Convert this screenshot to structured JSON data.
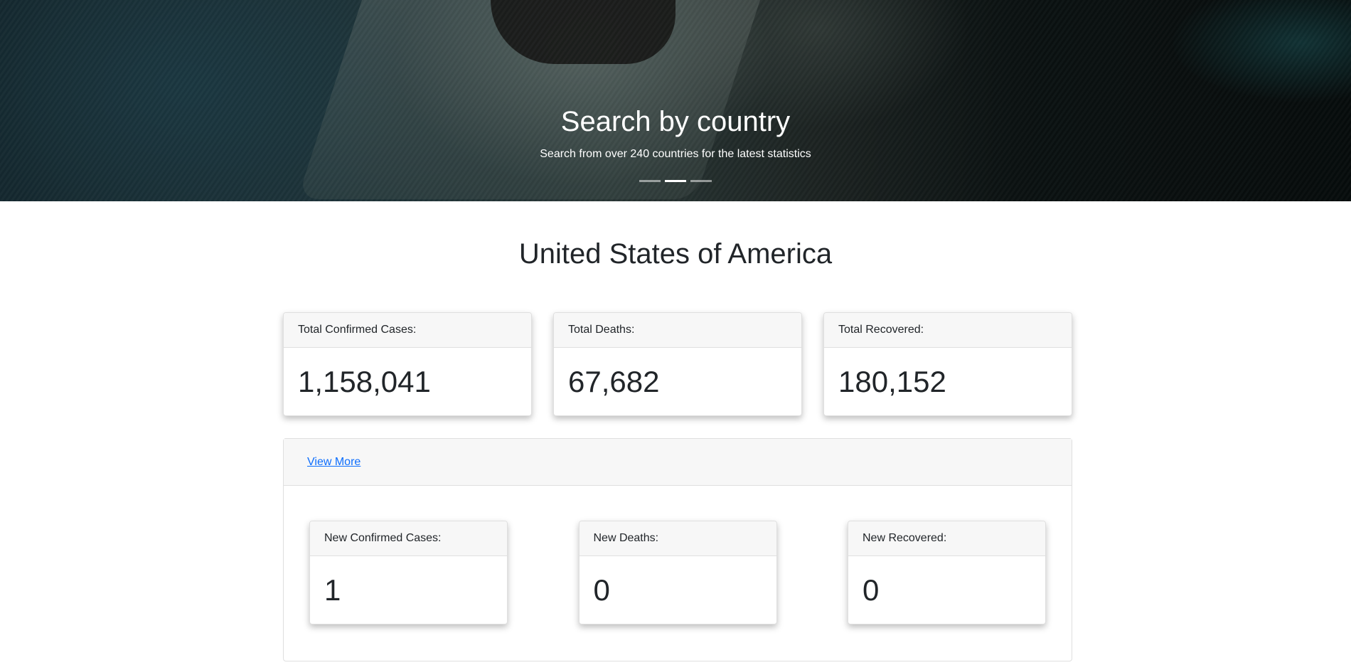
{
  "hero": {
    "title": "Search by country",
    "subtitle": "Search from over 240 countries for the latest statistics",
    "slide_count": 3,
    "active_slide": 2
  },
  "country": {
    "name": "United States of America"
  },
  "totals": [
    {
      "label": "Total Confirmed Cases:",
      "value": "1,158,041"
    },
    {
      "label": "Total Deaths:",
      "value": "67,682"
    },
    {
      "label": "Total Recovered:",
      "value": "180,152"
    }
  ],
  "more": {
    "link_label": "View More",
    "new_stats": [
      {
        "label": "New Confirmed Cases:",
        "value": "1"
      },
      {
        "label": "New Deaths:",
        "value": "0"
      },
      {
        "label": "New Recovered:",
        "value": "0"
      }
    ]
  },
  "colors": {
    "link": "#0d6efd",
    "card_header_bg": "#f7f7f7",
    "text": "#212529"
  }
}
